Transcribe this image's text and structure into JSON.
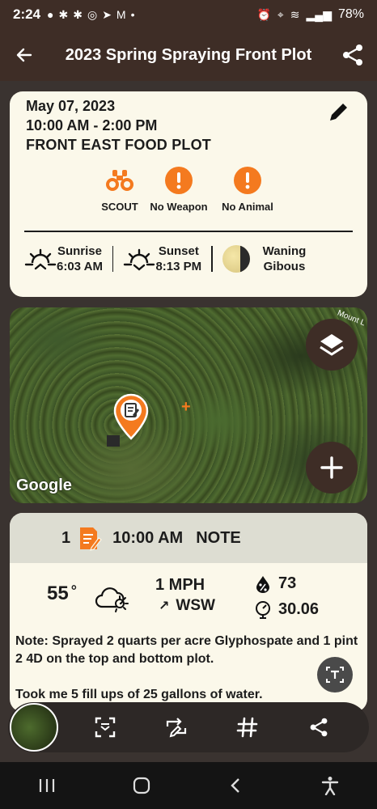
{
  "status_bar": {
    "time": "2:24",
    "battery": "78%"
  },
  "header": {
    "title": "2023 Spring Spraying Front Plot"
  },
  "event": {
    "date": "May 07, 2023",
    "time_range": "10:00 AM - 2:00 PM",
    "location": "FRONT EAST FOOD PLOT",
    "tags": [
      {
        "label": "SCOUT",
        "icon": "binoculars-icon"
      },
      {
        "label": "No Weapon",
        "icon": "alert-icon"
      },
      {
        "label": "No Animal",
        "icon": "alert-icon"
      }
    ],
    "sunrise_label": "Sunrise",
    "sunrise_time": "6:03 AM",
    "sunset_label": "Sunset",
    "sunset_time": "8:13 PM",
    "moon_line1": "Waning",
    "moon_line2": "Gibous"
  },
  "map": {
    "attribution": "Google",
    "road_label": "Mount L"
  },
  "note": {
    "number": "1",
    "time": "10:00 AM",
    "type": "NOTE",
    "temperature": "55",
    "degree": "°",
    "wind_speed": "1 MPH",
    "wind_direction": "WSW",
    "humidity": "73",
    "pressure": "30.06",
    "text1": "Note: Sprayed 2 quarts per acre Glyphospate and 1 pint 2 4D on the top and bottom plot.",
    "text2": "Took me 5 fill ups of 25 gallons of water."
  },
  "colors": {
    "header_bg": "#3e2d26",
    "accent_orange": "#f47a1f",
    "card_bg": "#fbf8ea"
  }
}
